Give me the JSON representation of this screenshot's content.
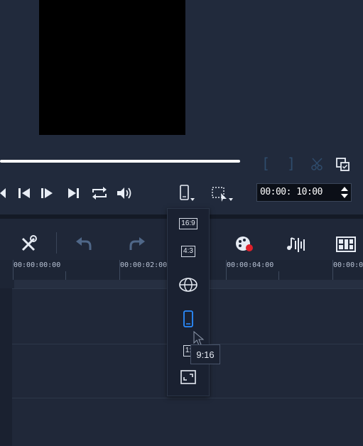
{
  "preview": {
    "timecode": "00:00: 10:00"
  },
  "transport": {
    "controls": [
      "skip-previous",
      "frame-back",
      "play",
      "skip-next",
      "repeat",
      "volume"
    ]
  },
  "timeline": {
    "ruler_labels": [
      "00:00:00:00",
      "00:00:02:00",
      "00:00:04:00",
      "00:00:0"
    ]
  },
  "aspect_menu": {
    "items": [
      "16:9",
      "4:3",
      "360",
      "9:16",
      "1:1",
      "fit"
    ],
    "label_169": "16:9",
    "label_43": "4:3",
    "label_11": "1:",
    "tooltip": "9:16"
  },
  "colors": {
    "accent": "#2b8cff",
    "record_dot": "#e0202a",
    "background": "#1b2334"
  }
}
